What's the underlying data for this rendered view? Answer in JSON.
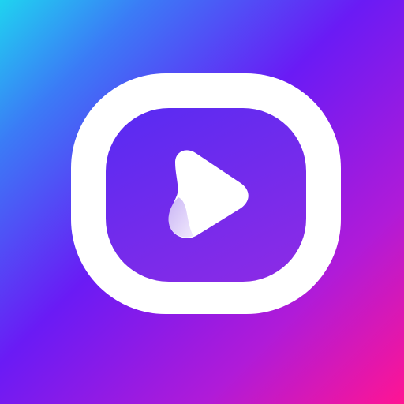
{
  "icon": {
    "name": "video-player-app-icon",
    "glyph": "play-icon",
    "colors": {
      "gradient_top_left": "#1FD3F0",
      "gradient_mid": "#6A1BF5",
      "gradient_bottom_right": "#FF1493",
      "inner_top": "#5B2BF2",
      "inner_bottom": "#8A2BE6",
      "ring": "#FFFFFF",
      "play_fold": "#D9C8F7"
    }
  }
}
